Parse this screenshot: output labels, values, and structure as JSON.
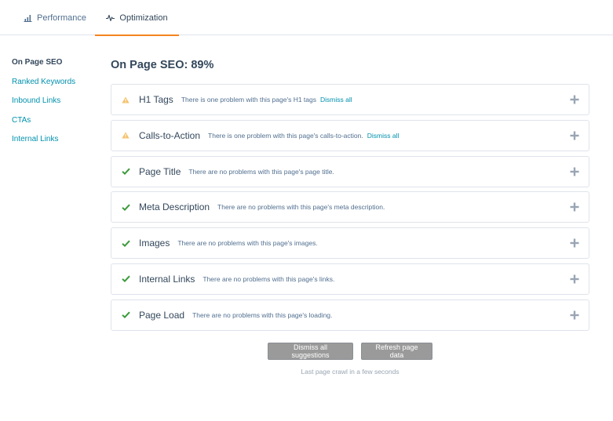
{
  "tabs": [
    {
      "label": "Performance",
      "icon": "bar-chart-icon"
    },
    {
      "label": "Optimization",
      "icon": "pulse-icon",
      "active": true
    }
  ],
  "sidebar": {
    "items": [
      {
        "label": "On Page SEO",
        "active": true
      },
      {
        "label": "Ranked Keywords"
      },
      {
        "label": "Inbound Links"
      },
      {
        "label": "CTAs"
      },
      {
        "label": "Internal Links"
      }
    ]
  },
  "main": {
    "title": "On Page SEO: 89%",
    "panels": [
      {
        "name": "H1 Tags",
        "status": "warning",
        "desc": "There is one problem with this page's H1 tags",
        "dismiss": "Dismiss all"
      },
      {
        "name": "Calls-to-Action",
        "status": "warning",
        "desc": "There is one problem with this page's calls-to-action.",
        "dismiss": "Dismiss all"
      },
      {
        "name": "Page Title",
        "status": "ok",
        "desc": "There are no problems with this page's page title."
      },
      {
        "name": "Meta Description",
        "status": "ok",
        "desc": "There are no problems with this page's meta description."
      },
      {
        "name": "Images",
        "status": "ok",
        "desc": "There are no problems with this page's images."
      },
      {
        "name": "Internal Links",
        "status": "ok",
        "desc": "There are no problems with this page's links."
      },
      {
        "name": "Page Load",
        "status": "ok",
        "desc": "There are no problems with this page's loading."
      }
    ],
    "buttons": {
      "dismiss_all": "Dismiss all suggestions",
      "refresh": "Refresh page data"
    },
    "crawl_note": "Last page crawl in a few seconds"
  },
  "colors": {
    "accent": "#f5841f",
    "link": "#0091ae",
    "warning": "#f5c26b",
    "ok": "#00a4bd",
    "check": "#3b9a3b"
  }
}
